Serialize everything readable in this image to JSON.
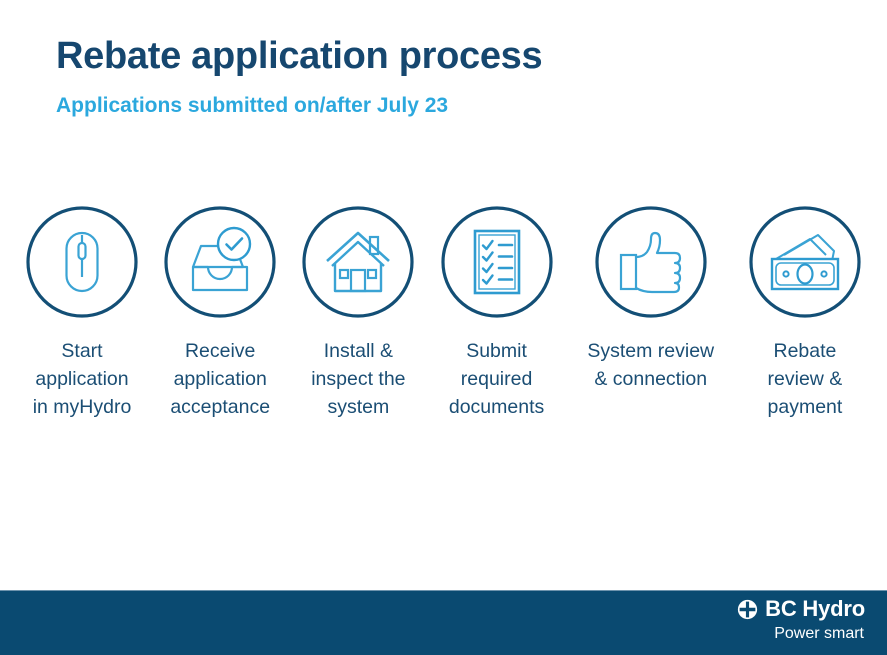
{
  "header": {
    "title": "Rebate application process",
    "subtitle": "Applications submitted on/after July 23"
  },
  "colors": {
    "title": "#16476F",
    "subtitle": "#2BA8DE",
    "label": "#1B4E74",
    "circle_stroke": "#134F76",
    "icon_stroke": "#2E9BD0",
    "footer_bg": "#0A4A71",
    "page_bg": "#FFFFFF"
  },
  "steps": [
    {
      "icon": "computer-mouse-icon",
      "label": "Start\napplication\nin myHydro"
    },
    {
      "icon": "inbox-tray-check-icon",
      "label": "Receive\napplication\nacceptance"
    },
    {
      "icon": "house-icon",
      "label": "Install &\ninspect the\nsystem"
    },
    {
      "icon": "checklist-document-icon",
      "label": "Submit\nrequired\ndocuments"
    },
    {
      "icon": "thumbs-up-icon",
      "label": "System review\n& connection"
    },
    {
      "icon": "banknotes-cash-icon",
      "label": "Rebate\nreview &\npayment"
    }
  ],
  "footer": {
    "brand_mark": "bc-hydro-emblem-icon",
    "brand_name": "BC Hydro",
    "tagline": "Power smart"
  }
}
